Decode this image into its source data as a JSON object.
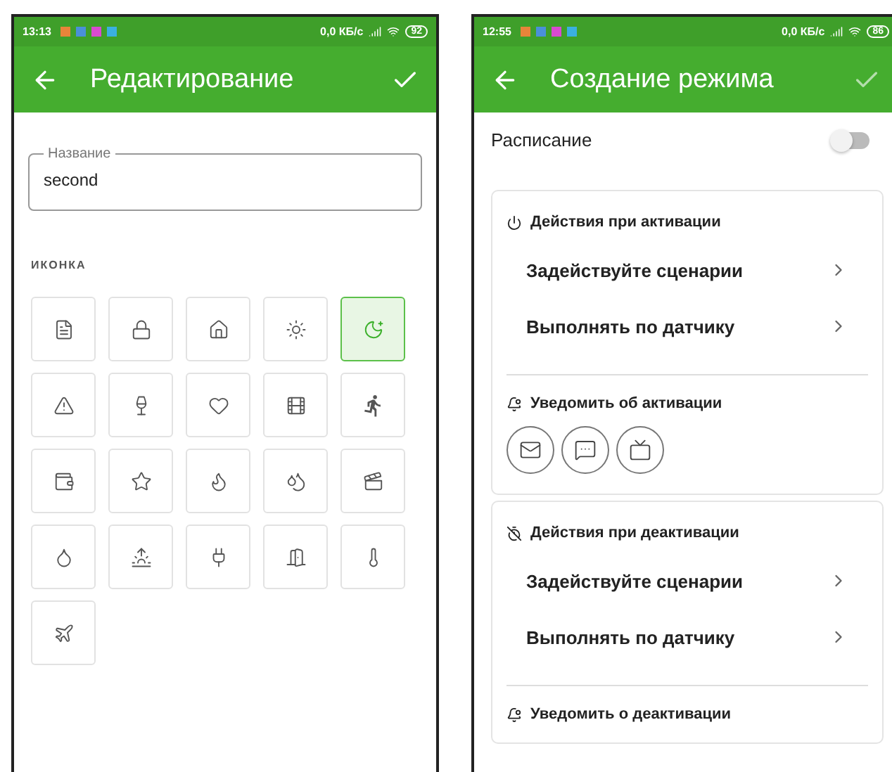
{
  "edit_screen": {
    "status_bar": {
      "time": "13:13",
      "speed": "0,0 КБ/с",
      "battery": "92"
    },
    "app_bar": {
      "title": "Редактирование"
    },
    "name_field": {
      "label": "Название",
      "value": "second"
    },
    "icon_section": {
      "title": "ИКОНКА",
      "options": [
        {
          "selected": false
        },
        {
          "selected": false
        },
        {
          "selected": false
        },
        {
          "selected": false
        },
        {
          "selected": true
        },
        {
          "selected": false
        },
        {
          "selected": false
        },
        {
          "selected": false
        },
        {
          "selected": false
        },
        {
          "selected": false
        },
        {
          "selected": false
        },
        {
          "selected": false
        },
        {
          "selected": false
        },
        {
          "selected": false
        },
        {
          "selected": false
        },
        {
          "selected": false
        },
        {
          "selected": false
        },
        {
          "selected": false
        },
        {
          "selected": false
        },
        {
          "selected": false
        },
        {
          "selected": false
        }
      ]
    }
  },
  "create_screen": {
    "status_bar": {
      "time": "12:55",
      "speed": "0,0 КБ/с",
      "battery": "86"
    },
    "app_bar": {
      "title": "Создание режима"
    },
    "schedule": {
      "label": "Расписание",
      "on": false
    },
    "cards": [
      {
        "kind": "activation",
        "title": "Действия при активации",
        "items": [
          "Задействуйте сценарии",
          "Выполнять по датчику"
        ],
        "notify_title": "Уведомить об активации",
        "notify_buttons": true
      },
      {
        "kind": "deactivation",
        "title": "Действия при деактивации",
        "items": [
          "Задействуйте сценарии",
          "Выполнять по датчику"
        ],
        "notify_title": "Уведомить о деактивации",
        "notify_buttons": false
      }
    ]
  }
}
